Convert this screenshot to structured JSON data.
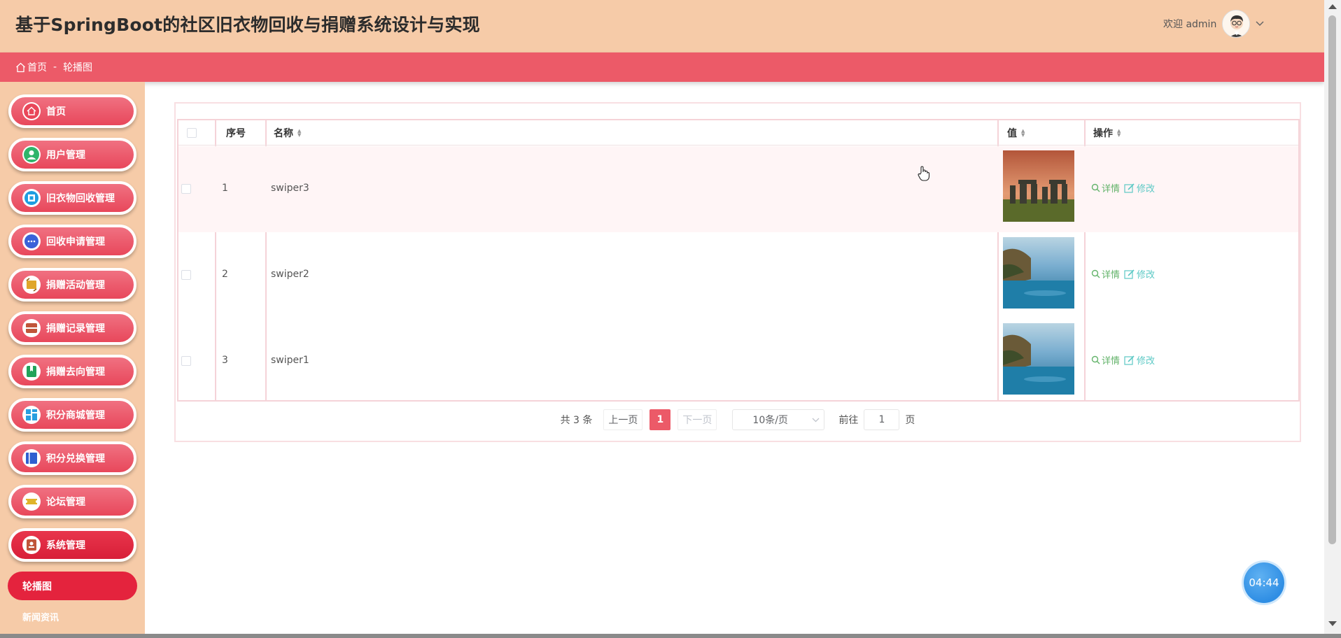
{
  "header": {
    "title": "基于SpringBoot的社区旧衣物回收与捐赠系统设计与实现",
    "welcome": "欢迎 admin"
  },
  "breadcrumb": {
    "home": "首页",
    "separator": "-",
    "current": "轮播图"
  },
  "sidebar": {
    "items": [
      {
        "label": "首页",
        "icon": "home-icon"
      },
      {
        "label": "用户管理",
        "icon": "user-icon"
      },
      {
        "label": "旧衣物回收管理",
        "icon": "chip-icon"
      },
      {
        "label": "回收申请管理",
        "icon": "chat-icon"
      },
      {
        "label": "捐赠活动管理",
        "icon": "crop-icon"
      },
      {
        "label": "捐赠记录管理",
        "icon": "box-icon"
      },
      {
        "label": "捐赠去向管理",
        "icon": "bookmark-icon"
      },
      {
        "label": "积分商城管理",
        "icon": "grid-icon"
      },
      {
        "label": "积分兑换管理",
        "icon": "book-icon"
      },
      {
        "label": "论坛管理",
        "icon": "ticket-icon"
      },
      {
        "label": "系统管理",
        "icon": "contact-icon"
      }
    ],
    "sub_active": "轮播图",
    "sub_next": "新闻资讯"
  },
  "table": {
    "headers": {
      "index": "序号",
      "name": "名称",
      "value": "值",
      "actions": "操作"
    },
    "rows": [
      {
        "index": "1",
        "name": "swiper3",
        "image": "stonehenge-image"
      },
      {
        "index": "2",
        "name": "swiper2",
        "image": "lake-image"
      },
      {
        "index": "3",
        "name": "swiper1",
        "image": "lake-image"
      }
    ],
    "action_detail": "详情",
    "action_edit": "修改"
  },
  "pagination": {
    "total": "共 3 条",
    "prev": "上一页",
    "current_page": "1",
    "next": "下一页",
    "page_size": "10条/页",
    "goto_label": "前往",
    "goto_value": "1",
    "goto_suffix": "页"
  },
  "timer": "04:44",
  "colors": {
    "header_bg": "#f6cba8",
    "accent": "#ec5a68",
    "menu_red": "#e8475b",
    "detail_green": "#63b36a",
    "edit_teal": "#5cc9c5"
  }
}
